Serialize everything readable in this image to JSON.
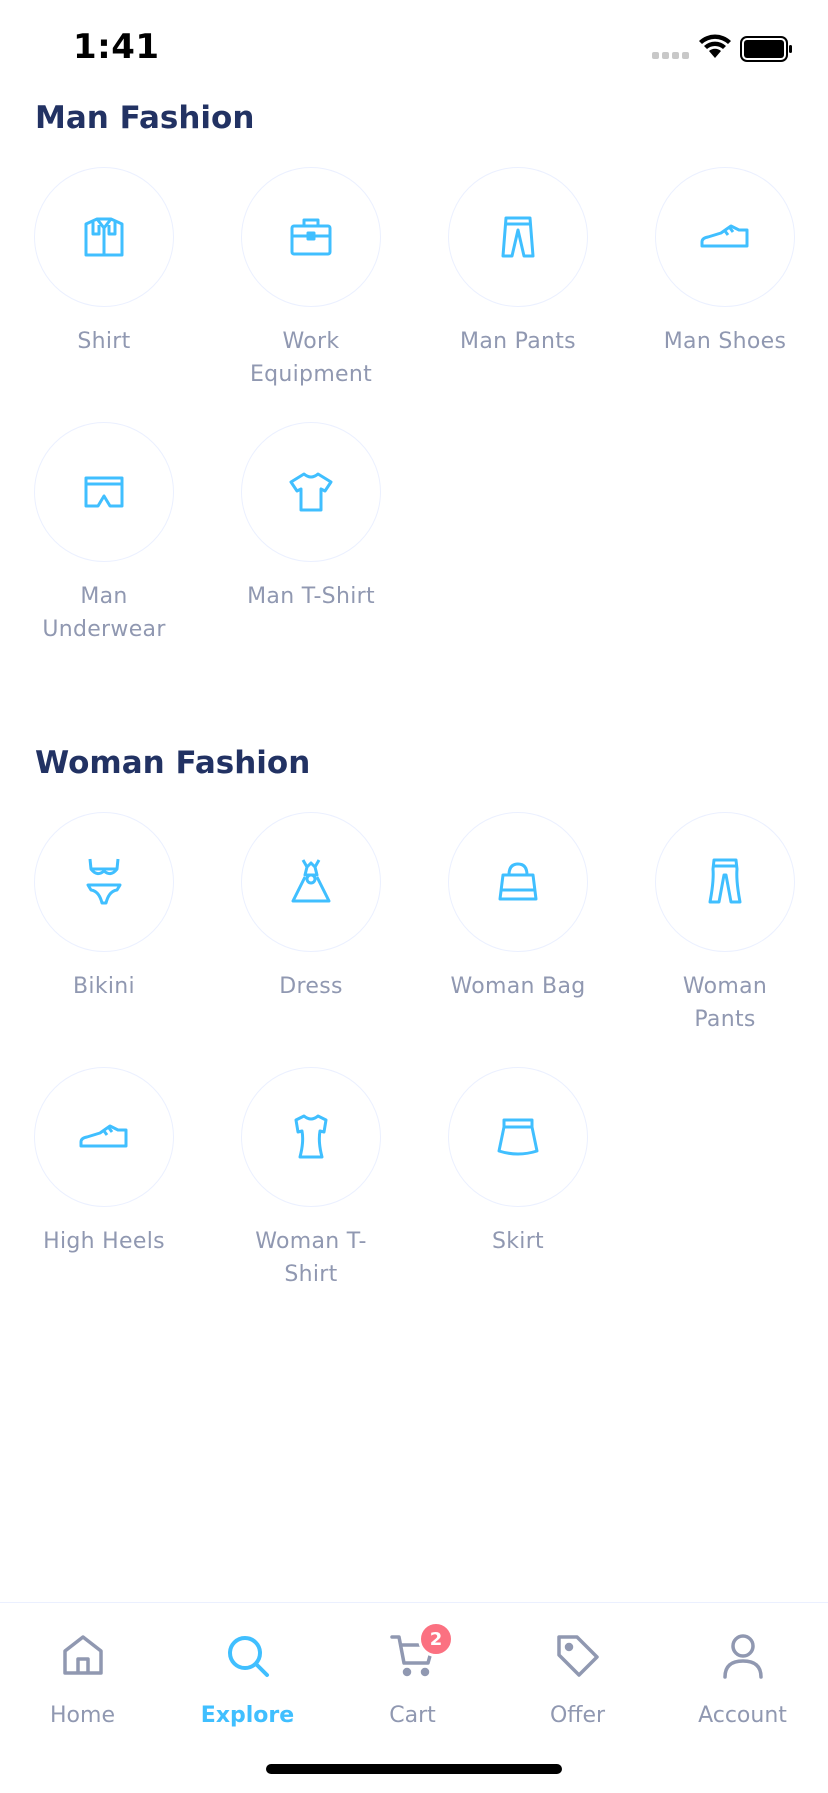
{
  "status_bar": {
    "time": "1:41"
  },
  "colors": {
    "accent": "#40bfff",
    "title": "#223263",
    "muted": "#9098b1",
    "badge": "#fb7181",
    "border": "#ebf0ff"
  },
  "sections": [
    {
      "title": "Man Fashion",
      "items": [
        {
          "label": "Shirt",
          "icon": "shirt-icon"
        },
        {
          "label": "Work Equipment",
          "icon": "briefcase-icon"
        },
        {
          "label": "Man Pants",
          "icon": "pants-icon"
        },
        {
          "label": "Man Shoes",
          "icon": "shoe-icon"
        },
        {
          "label": "Man Underwear",
          "icon": "underwear-icon"
        },
        {
          "label": "Man T-Shirt",
          "icon": "tshirt-icon"
        }
      ]
    },
    {
      "title": "Woman Fashion",
      "items": [
        {
          "label": "Bikini",
          "icon": "bikini-icon"
        },
        {
          "label": "Dress",
          "icon": "dress-icon"
        },
        {
          "label": "Woman Bag",
          "icon": "bag-icon"
        },
        {
          "label": "Woman Pants",
          "icon": "woman-pants-icon"
        },
        {
          "label": "High Heels",
          "icon": "high-heels-icon"
        },
        {
          "label": "Woman T-Shirt",
          "icon": "woman-tshirt-icon"
        },
        {
          "label": "Skirt",
          "icon": "skirt-icon"
        }
      ]
    }
  ],
  "tabbar": {
    "tabs": [
      {
        "label": "Home",
        "icon": "home-icon"
      },
      {
        "label": "Explore",
        "icon": "search-icon",
        "active": true
      },
      {
        "label": "Cart",
        "icon": "cart-icon",
        "badge": "2"
      },
      {
        "label": "Offer",
        "icon": "tag-icon"
      },
      {
        "label": "Account",
        "icon": "user-icon"
      }
    ]
  }
}
